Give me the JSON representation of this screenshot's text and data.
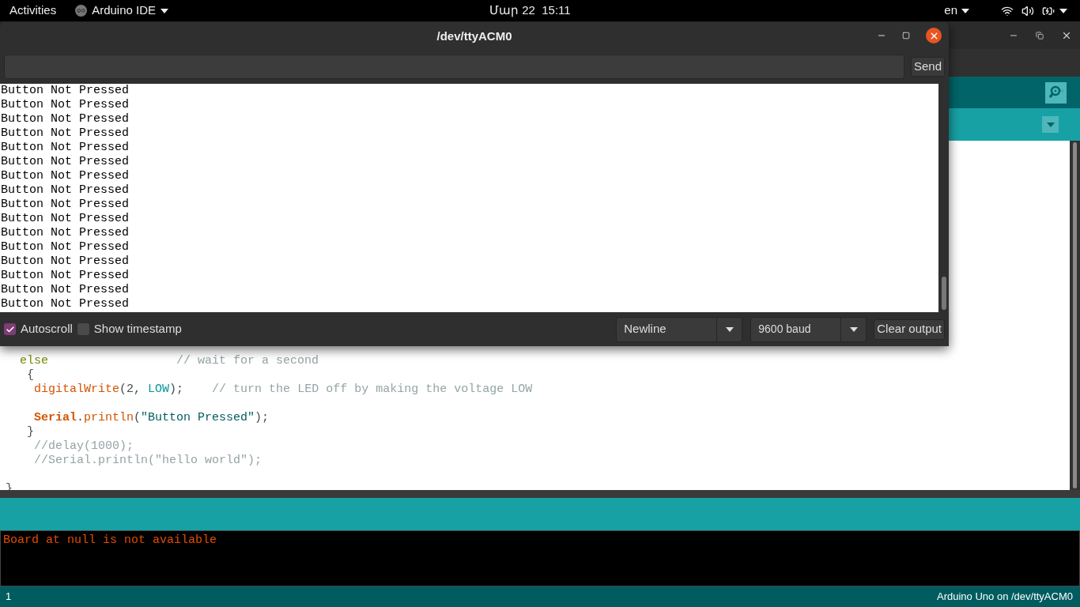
{
  "top_bar": {
    "activities": "Activities",
    "app_menu": "Arduino IDE",
    "clock": "Մար 22  15:11",
    "language": "en"
  },
  "ide": {
    "editor": {
      "lines": [
        {
          "blank_before": false,
          "tokens": [
            {
              "kind": "keyword",
              "text": "  else"
            },
            {
              "kind": "comment",
              "text": "                  // wait for a second"
            }
          ]
        },
        {
          "blank_before": false,
          "tokens": [
            {
              "kind": "plain",
              "text": "   {"
            }
          ]
        },
        {
          "blank_before": false,
          "tokens": [
            {
              "kind": "function",
              "text": "    digitalWrite"
            },
            {
              "kind": "plain",
              "text": "(2, "
            },
            {
              "kind": "constant",
              "text": "LOW"
            },
            {
              "kind": "plain",
              "text": ");"
            },
            {
              "kind": "comment",
              "text": "    // turn the LED off by making the voltage LOW"
            }
          ]
        },
        {
          "blank_before": true,
          "tokens": [
            {
              "kind": "class",
              "text": "    Serial"
            },
            {
              "kind": "plain",
              "text": "."
            },
            {
              "kind": "function",
              "text": "println"
            },
            {
              "kind": "plain",
              "text": "("
            },
            {
              "kind": "string",
              "text": "\"Button Pressed\""
            },
            {
              "kind": "plain",
              "text": ");"
            }
          ]
        },
        {
          "blank_before": false,
          "tokens": [
            {
              "kind": "plain",
              "text": "   }"
            }
          ]
        },
        {
          "blank_before": false,
          "tokens": [
            {
              "kind": "comment",
              "text": "    //delay(1000);"
            }
          ]
        },
        {
          "blank_before": false,
          "tokens": [
            {
              "kind": "comment",
              "text": "    //Serial.println(\"hello world\");"
            }
          ]
        },
        {
          "blank_before": true,
          "tokens": [
            {
              "kind": "plain",
              "text": "}"
            }
          ]
        }
      ]
    },
    "console": {
      "lines": [
        "Board at null is not available"
      ]
    },
    "status_bar": {
      "line": "1",
      "board": "Arduino Uno on /dev/ttyACM0"
    }
  },
  "serial_monitor": {
    "title": "/dev/ttyACM0",
    "send_button": "Send",
    "output": [
      "Button Not Pressed",
      "Button Not Pressed",
      "Button Not Pressed",
      "Button Not Pressed",
      "Button Not Pressed",
      "Button Not Pressed",
      "Button Not Pressed",
      "Button Not Pressed",
      "Button Not Pressed",
      "Button Not Pressed",
      "Button Not Pressed",
      "Button Not Pressed",
      "Button Not Pressed",
      "Button Not Pressed",
      "Button Not Pressed",
      "Button Not Pressed"
    ],
    "autoscroll": {
      "label": "Autoscroll",
      "checked": true
    },
    "show_timestamp": {
      "label": "Show timestamp",
      "checked": false
    },
    "line_ending": "Newline",
    "baud": "9600 baud",
    "clear_button": "Clear output"
  }
}
